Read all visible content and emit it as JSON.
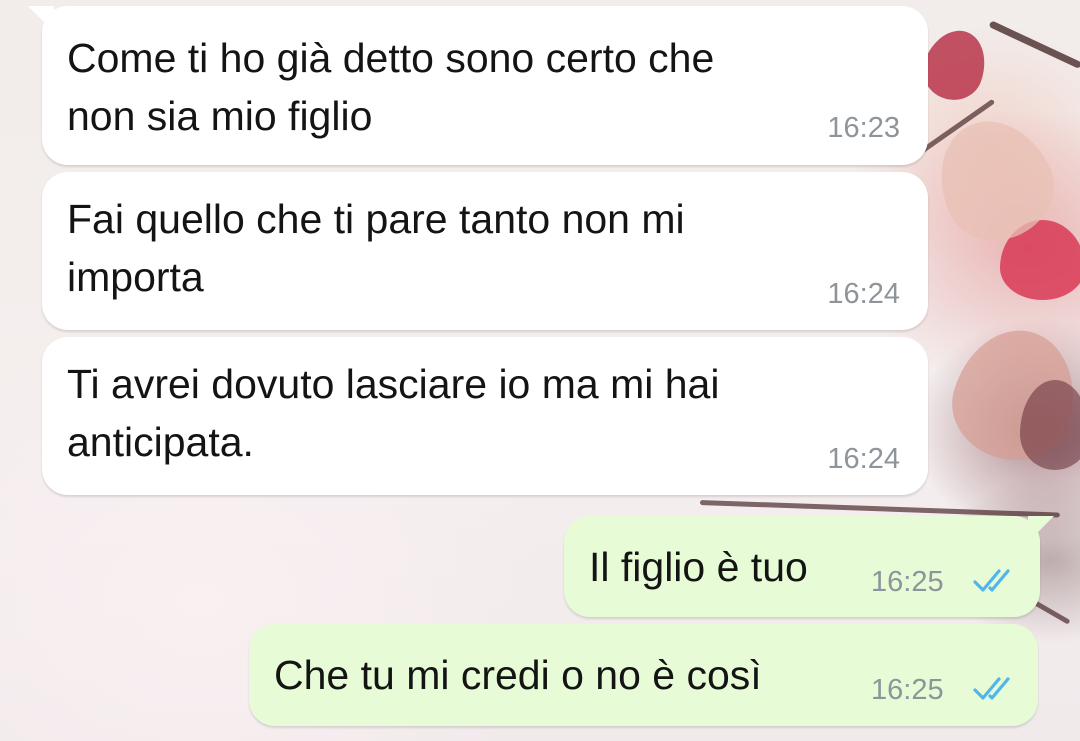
{
  "messages": [
    {
      "direction": "incoming",
      "text": "Come ti ho già detto sono certo che\nnon sia mio figlio",
      "time": "16:23"
    },
    {
      "direction": "incoming",
      "text": "Fai quello che ti pare tanto non mi\nimporta",
      "time": "16:24"
    },
    {
      "direction": "incoming",
      "text": "Ti avrei dovuto lasciare io ma mi hai\nanticipata.",
      "time": "16:24"
    },
    {
      "direction": "outgoing",
      "text": "Il figlio è tuo",
      "time": "16:25",
      "status": "read"
    },
    {
      "direction": "outgoing",
      "text": "Che tu mi credi o no è così",
      "time": "16:25",
      "status": "read"
    }
  ],
  "colors": {
    "incoming_bubble": "#ffffff",
    "outgoing_bubble": "#e7fcd6",
    "read_ticks": "#4fb6ec",
    "timestamp": "#8d949a"
  }
}
